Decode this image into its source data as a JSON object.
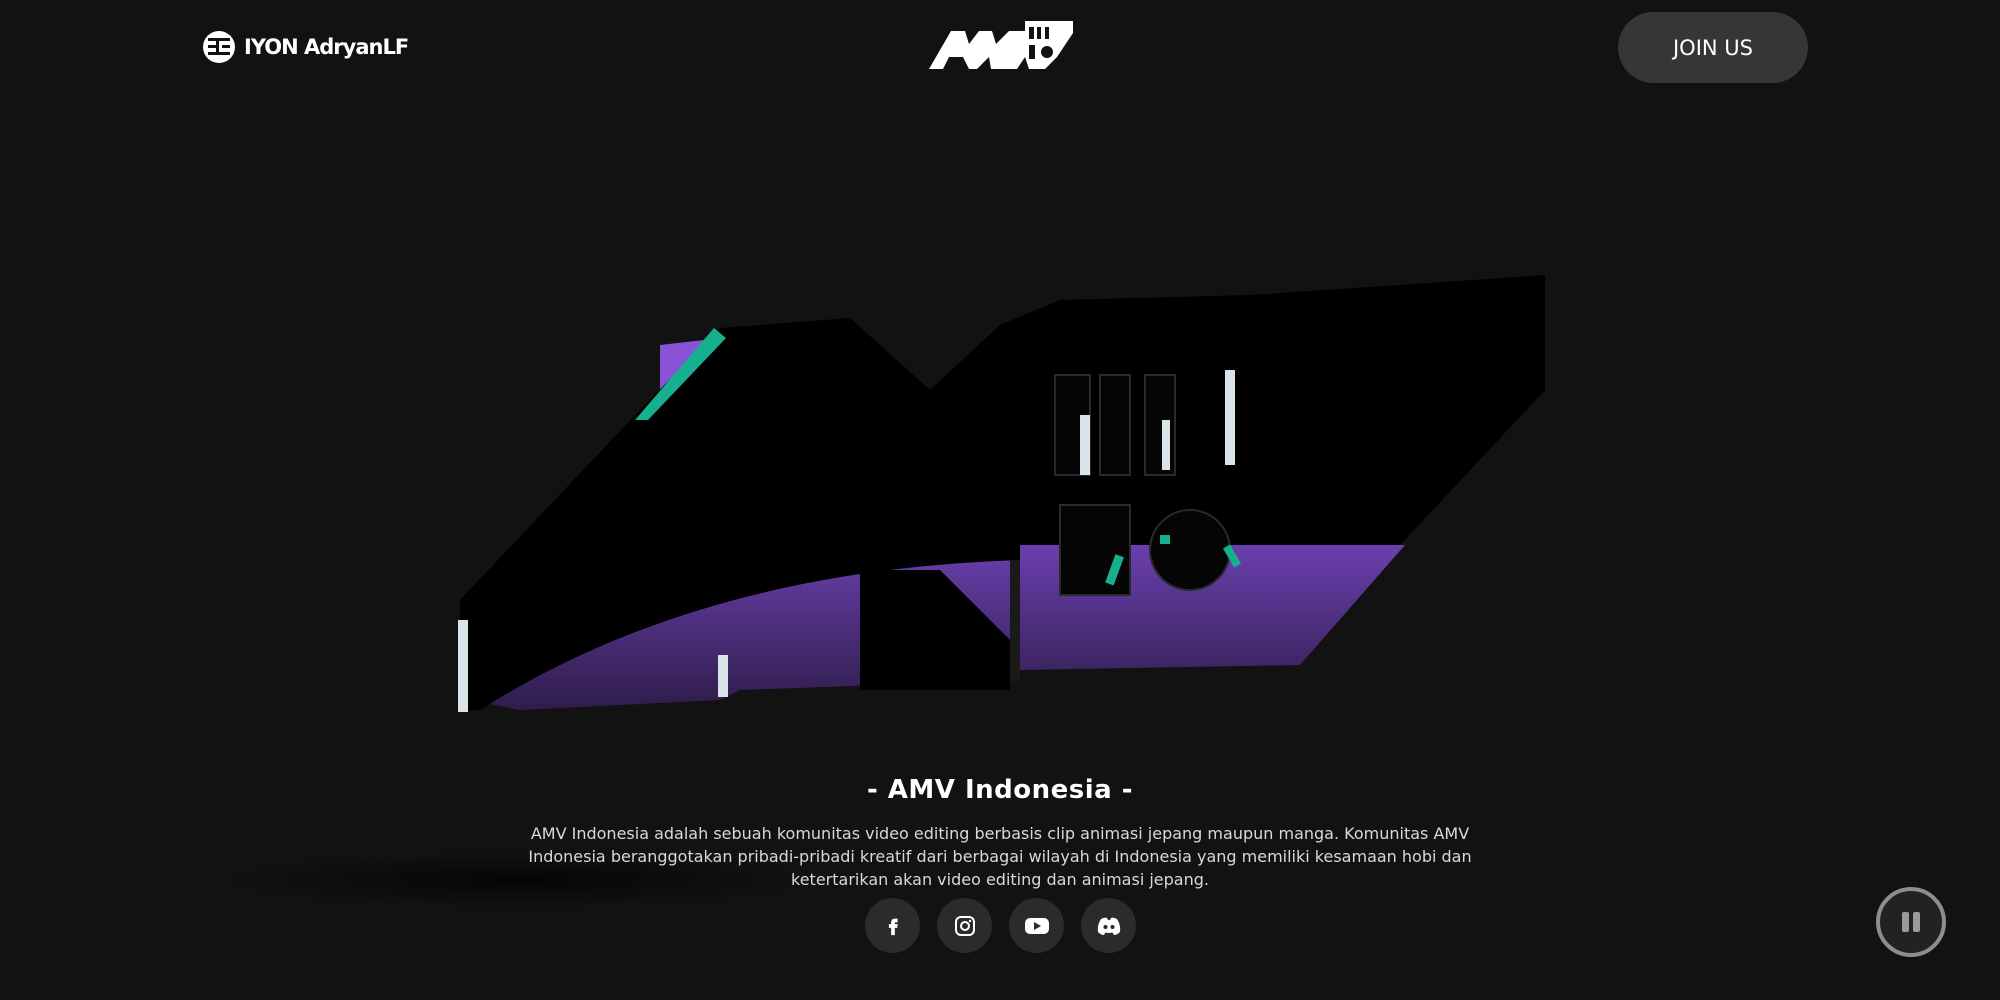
{
  "header": {
    "author_name": "IYON AdryanLF",
    "author_icon": "author-badge-icon",
    "logo_text": "AMV iNDO",
    "join_label": "JOIN US"
  },
  "hero": {
    "logo_text": "AMV iNDO",
    "colors": {
      "purple": "#8a52d6",
      "teal": "#16b08e",
      "face": "#000000"
    }
  },
  "info": {
    "title": "- AMV Indonesia -",
    "description": "AMV Indonesia adalah sebuah komunitas video editing berbasis clip animasi jepang maupun manga. Komunitas AMV Indonesia beranggotakan pribadi-pribadi kreatif dari berbagai wilayah di Indonesia yang memiliki kesamaan hobi dan ketertarikan akan video editing dan animasi jepang."
  },
  "socials": [
    {
      "name": "facebook",
      "icon": "facebook-icon"
    },
    {
      "name": "instagram",
      "icon": "instagram-icon"
    },
    {
      "name": "youtube",
      "icon": "youtube-icon"
    },
    {
      "name": "discord",
      "icon": "discord-icon"
    }
  ],
  "player": {
    "state": "playing",
    "icon": "pause-icon"
  }
}
